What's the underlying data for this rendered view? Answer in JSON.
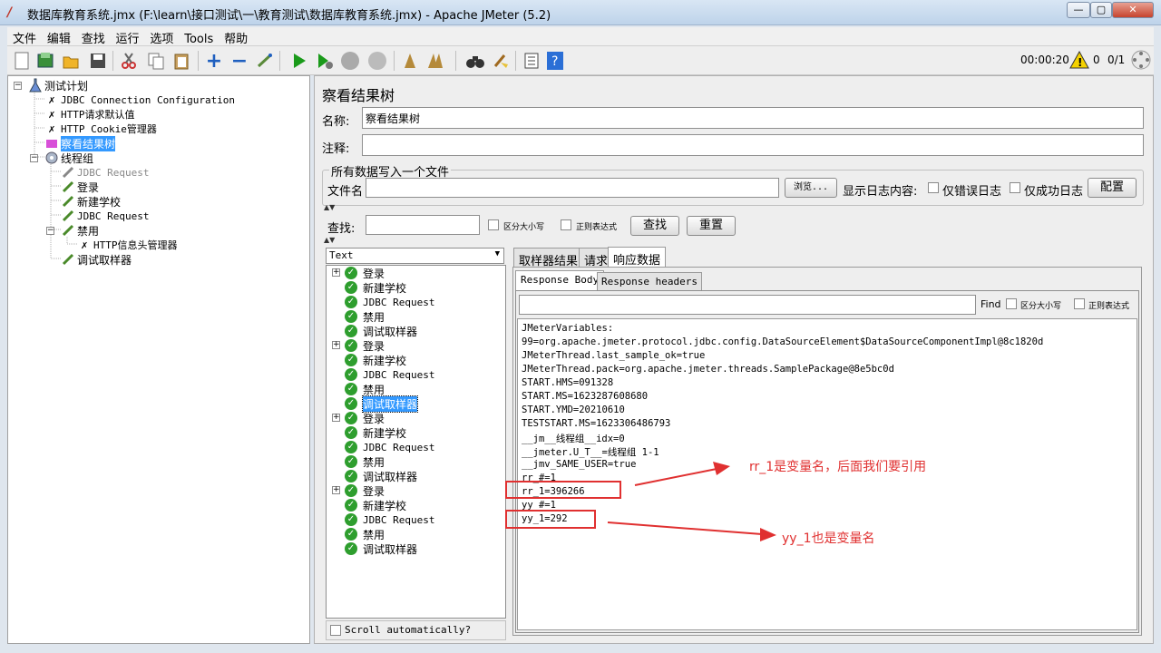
{
  "window": {
    "title": "数据库教育系统.jmx (F:\\learn\\接口测试\\一\\教育测试\\数据库教育系统.jmx) - Apache JMeter (5.2)",
    "minimize": "—",
    "maximize": "▢",
    "close": "✕"
  },
  "menu": [
    "文件",
    "编辑",
    "查找",
    "运行",
    "选项",
    "Tools",
    "帮助"
  ],
  "toolbar_status": {
    "elapsed": "00:00:20",
    "warnings": "0",
    "threads": "0/1"
  },
  "tree": {
    "items": [
      {
        "label": "测试计划",
        "icon": "test-plan-icon"
      },
      {
        "label": "JDBC Connection Configuration",
        "icon": "config-wrench-icon"
      },
      {
        "label": "HTTP请求默认值",
        "icon": "config-wrench-icon"
      },
      {
        "label": "HTTP Cookie管理器",
        "icon": "config-wrench-icon"
      },
      {
        "label": "察看结果树",
        "icon": "listener-icon"
      },
      {
        "label": "线程组",
        "icon": "thread-group-gear-icon"
      },
      {
        "label": "JDBC Request",
        "icon": "sampler-pipette-icon"
      },
      {
        "label": "登录",
        "icon": "sampler-pipette-icon"
      },
      {
        "label": "新建学校",
        "icon": "sampler-pipette-icon"
      },
      {
        "label": "JDBC Request",
        "icon": "sampler-pipette-icon"
      },
      {
        "label": "禁用",
        "icon": "sampler-pipette-icon"
      },
      {
        "label": "HTTP信息头管理器",
        "icon": "config-wrench-icon"
      },
      {
        "label": "调试取样器",
        "icon": "sampler-pipette-icon"
      }
    ]
  },
  "panel": {
    "heading": "察看结果树",
    "name_label": "名称:",
    "name_value": "察看结果树",
    "comment_label": "注释:",
    "comment_value": "",
    "file_section_title": "所有数据写入一个文件",
    "filename_label": "文件名",
    "filename_value": "",
    "browse_button": "浏览...",
    "log_display_label": "显示日志内容:",
    "errors_only_label": "仅错误日志",
    "success_only_label": "仅成功日志",
    "configure_button": "配置",
    "search_label": "查找:",
    "search_value": "",
    "case_sensitive_label": "区分大小写",
    "regex_label": "正则表达式",
    "search_button": "查找",
    "reset_button": "重置"
  },
  "results": {
    "renderer": "Text",
    "items": [
      {
        "label": "登录",
        "mono": false,
        "expandable": true,
        "selected": false
      },
      {
        "label": "新建学校",
        "mono": false,
        "expandable": false,
        "selected": false
      },
      {
        "label": "JDBC Request",
        "mono": true,
        "expandable": false,
        "selected": false
      },
      {
        "label": "禁用",
        "mono": false,
        "expandable": false,
        "selected": false
      },
      {
        "label": "调试取样器",
        "mono": false,
        "expandable": false,
        "selected": false
      },
      {
        "label": "登录",
        "mono": false,
        "expandable": true,
        "selected": false
      },
      {
        "label": "新建学校",
        "mono": false,
        "expandable": false,
        "selected": false
      },
      {
        "label": "JDBC Request",
        "mono": true,
        "expandable": false,
        "selected": false
      },
      {
        "label": "禁用",
        "mono": false,
        "expandable": false,
        "selected": false
      },
      {
        "label": "调试取样器",
        "mono": false,
        "expandable": false,
        "selected": true
      },
      {
        "label": "登录",
        "mono": false,
        "expandable": true,
        "selected": false
      },
      {
        "label": "新建学校",
        "mono": false,
        "expandable": false,
        "selected": false
      },
      {
        "label": "JDBC Request",
        "mono": true,
        "expandable": false,
        "selected": false
      },
      {
        "label": "禁用",
        "mono": false,
        "expandable": false,
        "selected": false
      },
      {
        "label": "调试取样器",
        "mono": false,
        "expandable": false,
        "selected": false
      },
      {
        "label": "登录",
        "mono": false,
        "expandable": true,
        "selected": false
      },
      {
        "label": "新建学校",
        "mono": false,
        "expandable": false,
        "selected": false
      },
      {
        "label": "JDBC Request",
        "mono": true,
        "expandable": false,
        "selected": false
      },
      {
        "label": "禁用",
        "mono": false,
        "expandable": false,
        "selected": false
      },
      {
        "label": "调试取样器",
        "mono": false,
        "expandable": false,
        "selected": false
      }
    ],
    "scroll_auto_label": "Scroll automatically?"
  },
  "tabs": {
    "main": [
      "取样器结果",
      "请求",
      "响应数据"
    ],
    "sub": [
      "Response Body",
      "Response headers"
    ]
  },
  "find_bar": {
    "find_label": "Find",
    "case_label": "区分大小写",
    "regex_label": "正则表达式",
    "value": ""
  },
  "response_lines": [
    "JMeterVariables:",
    "99=org.apache.jmeter.protocol.jdbc.config.DataSourceElement$DataSourceComponentImpl@8c1820d",
    "JMeterThread.last_sample_ok=true",
    "JMeterThread.pack=org.apache.jmeter.threads.SamplePackage@8e5bc0d",
    "START.HMS=091328",
    "START.MS=1623287608680",
    "START.YMD=20210610",
    "TESTSTART.MS=1623306486793",
    "__jm__线程组__idx=0",
    "__jmeter.U_T__=线程组 1-1",
    "__jmv_SAME_USER=true",
    "rr_#=1",
    "rr_1=396266",
    "yy_#=1",
    "yy_1=292"
  ],
  "annotations": {
    "rr": "rr_1是变量名，后面我们要引用",
    "yy": "yy_1也是变量名",
    "color": "#e03030"
  }
}
